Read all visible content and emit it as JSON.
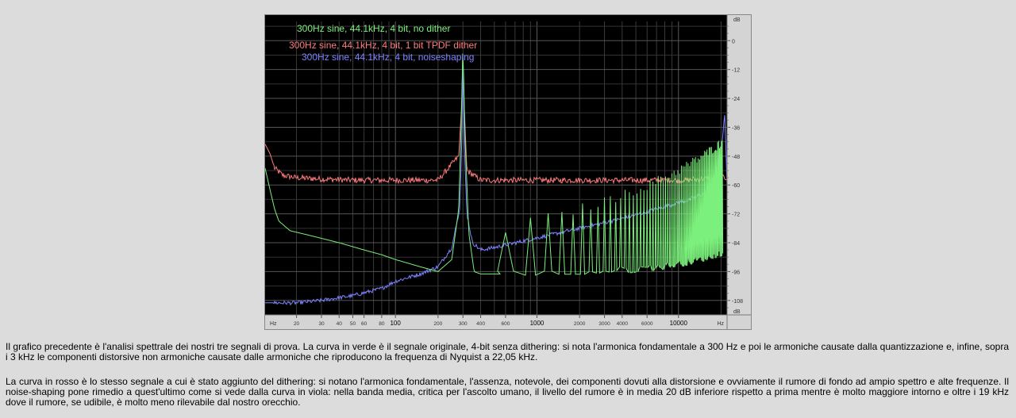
{
  "link": {
    "text": ""
  },
  "chart_data": {
    "type": "line",
    "x_scale": "log",
    "x_unit": "Hz",
    "y_unit": "dB",
    "xlim": [
      12,
      22050
    ],
    "ylim": [
      -114,
      8
    ],
    "grid": true,
    "legend_placement": "top-left",
    "x_ticks": [
      {
        "v": 20,
        "label": "20"
      },
      {
        "v": 30,
        "label": "30"
      },
      {
        "v": 40,
        "label": "40"
      },
      {
        "v": 50,
        "label": "50"
      },
      {
        "v": 60,
        "label": "60"
      },
      {
        "v": 80,
        "label": "80"
      },
      {
        "v": 100,
        "label": "100"
      },
      {
        "v": 200,
        "label": "200"
      },
      {
        "v": 300,
        "label": "300"
      },
      {
        "v": 400,
        "label": "400"
      },
      {
        "v": 600,
        "label": "600"
      },
      {
        "v": 1000,
        "label": "1000"
      },
      {
        "v": 2000,
        "label": "2000"
      },
      {
        "v": 3000,
        "label": "3000"
      },
      {
        "v": 4000,
        "label": "4000"
      },
      {
        "v": 6000,
        "label": "6000"
      },
      {
        "v": 10000,
        "label": "10000"
      }
    ],
    "x_unit_labels": [
      "Hz",
      "Hz"
    ],
    "y_ticks": [
      {
        "v": 0,
        "label": "0"
      },
      {
        "v": -12,
        "label": "-12"
      },
      {
        "v": -24,
        "label": "-24"
      },
      {
        "v": -36,
        "label": "-36"
      },
      {
        "v": -48,
        "label": "-48"
      },
      {
        "v": -60,
        "label": "-60"
      },
      {
        "v": -72,
        "label": "-72"
      },
      {
        "v": -84,
        "label": "-84"
      },
      {
        "v": -96,
        "label": "-96"
      },
      {
        "v": -108,
        "label": "-108"
      }
    ],
    "y_unit_labels": [
      "dB",
      "dB"
    ],
    "series": [
      {
        "name": "300Hz sine, 44.1kHz, 4 bit, no dither",
        "color": "#7cf07c",
        "x": [
          12,
          13,
          14,
          15,
          18,
          25,
          40,
          60,
          80,
          100,
          150,
          200,
          250,
          280,
          290,
          300,
          310,
          330,
          360,
          400,
          450
        ],
        "y": [
          -53,
          -62,
          -70,
          -75,
          -79,
          -81,
          -84,
          -87,
          -89,
          -91,
          -94,
          -96,
          -91,
          -70,
          -40,
          -2,
          -40,
          -80,
          -96,
          -97,
          -97
        ],
        "harmonics": {
          "fundamental_hz": 300,
          "start_hz": 600,
          "end_hz": 20500,
          "peak_start_db": -80,
          "peak_end_db": -42,
          "floor_start_db": -97,
          "floor_end_db": -88
        }
      },
      {
        "name": "300Hz sine, 44.1kHz, 4 bit, 1 bit TPDF dither",
        "color": "#ff7b7b",
        "x": [
          12,
          13,
          14,
          16,
          20,
          30,
          50,
          100,
          200,
          280,
          295,
          300,
          305,
          320,
          400,
          1000,
          3000,
          10000,
          20000,
          22050
        ],
        "y": [
          -43,
          -47,
          -53,
          -56,
          -57,
          -57.5,
          -58,
          -58,
          -58,
          -48,
          -25,
          -3,
          -25,
          -54,
          -58,
          -58,
          -58,
          -58,
          -57,
          -57
        ],
        "noise_db": 1.2
      },
      {
        "name": "300Hz sine, 44.1kHz, 4 bit, noiseshaping",
        "color": "#7d84ff",
        "x": [
          12,
          20,
          30,
          50,
          80,
          100,
          150,
          200,
          250,
          285,
          295,
          300,
          305,
          320,
          350,
          400,
          500,
          1000,
          2000,
          4000,
          8000,
          12000,
          16000,
          18000,
          19500,
          20500,
          21200,
          22050
        ],
        "y": [
          -109,
          -109,
          -108,
          -106,
          -103,
          -100,
          -97,
          -94,
          -86,
          -70,
          -40,
          -3,
          -40,
          -72,
          -84,
          -87,
          -86,
          -82,
          -78,
          -74,
          -69,
          -66,
          -63,
          -58,
          -52,
          -40,
          -30,
          -60
        ],
        "noise_db": 0.8
      }
    ]
  },
  "text": {
    "p1": "Il grafico precedente è l'analisi spettrale dei nostri tre segnali di prova. La curva in verde è il segnale originale, 4-bit senza dithering: si nota l'armonica fondamentale a 300 Hz e poi le armoniche causate dalla quantizzazione e, infine, sopra i 3 kHz le componenti distorsive non armoniche causate dalle armoniche che riproducono la frequenza di Nyquist a 22,05 kHz.",
    "p2": "La curva in rosso è lo stesso segnale a cui è stato aggiunto del dithering: si notano l'armonica fondamentale, l'assenza, notevole, dei componenti dovuti alla distorsione e ovviamente il rumore di fondo ad ampio spettro e alte frequenze. Il noise-shaping pone rimedio a quest'ultimo come si vede dalla curva in viola: nella banda media, critica per l'ascolto umano, il livello del rumore è in media 20 dB inferiore rispetto a prima mentre è molto maggiore intorno e oltre i 19 kHz dove il rumore, se udibile, è molto meno rilevabile dal nostro orecchio."
  }
}
